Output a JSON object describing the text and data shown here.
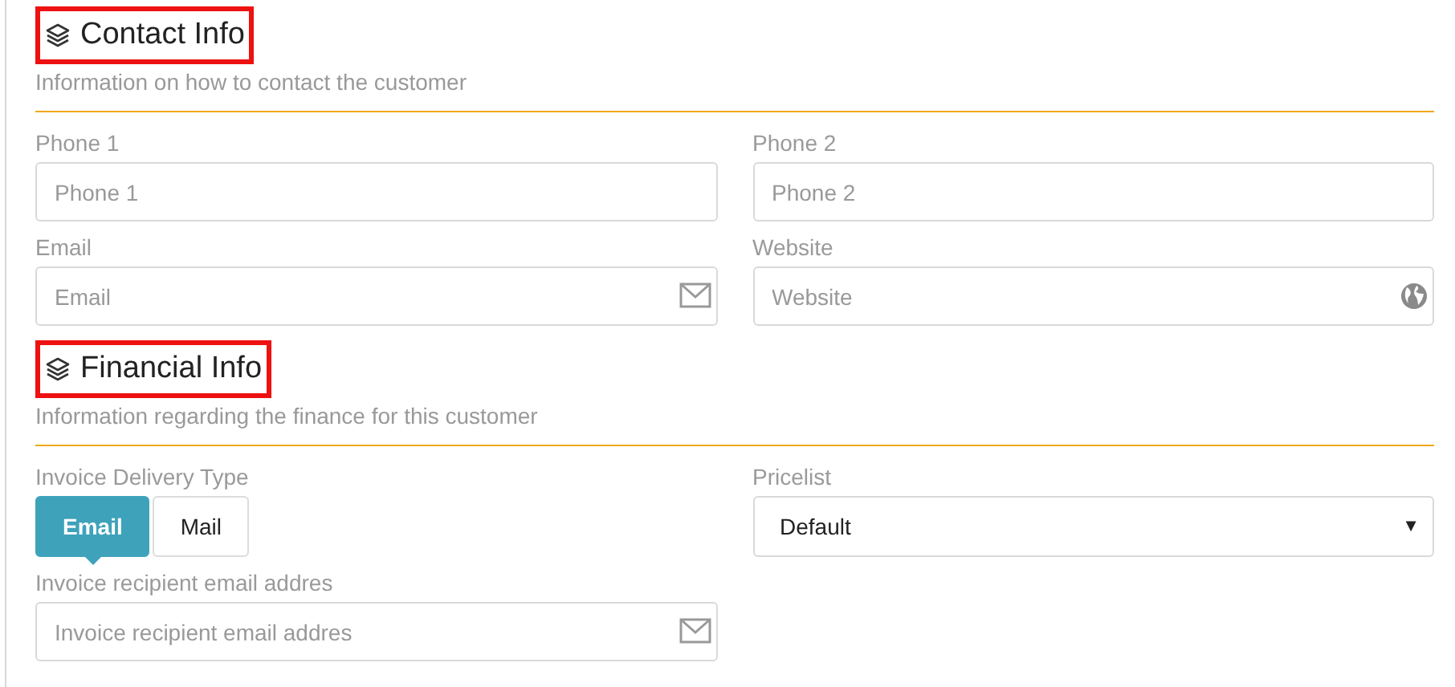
{
  "sections": [
    {
      "title": "Contact Info",
      "subtitle": "Information on how to contact the customer",
      "columns": [
        [
          {
            "kind": "phone",
            "label": "Phone 1",
            "placeholder": "Phone 1"
          },
          {
            "kind": "email",
            "label": "Email",
            "placeholder": "Email"
          }
        ],
        [
          {
            "kind": "phone",
            "label": "Phone 2",
            "placeholder": "Phone 2"
          },
          {
            "kind": "website",
            "label": "Website",
            "placeholder": "Website"
          }
        ]
      ]
    },
    {
      "title": "Financial Info",
      "subtitle": "Information regarding the finance for this customer",
      "columns": [
        [
          {
            "kind": "toggle",
            "label": "Invoice Delivery Type",
            "options": [
              {
                "label": "Email",
                "selected": true
              },
              {
                "label": "Mail",
                "selected": false
              }
            ]
          },
          {
            "kind": "email",
            "label": "Invoice recipient email addres",
            "placeholder": "Invoice recipient email addres"
          }
        ],
        [
          {
            "kind": "select",
            "label": "Pricelist",
            "value": "Default",
            "arrow": "▼"
          }
        ]
      ]
    }
  ]
}
